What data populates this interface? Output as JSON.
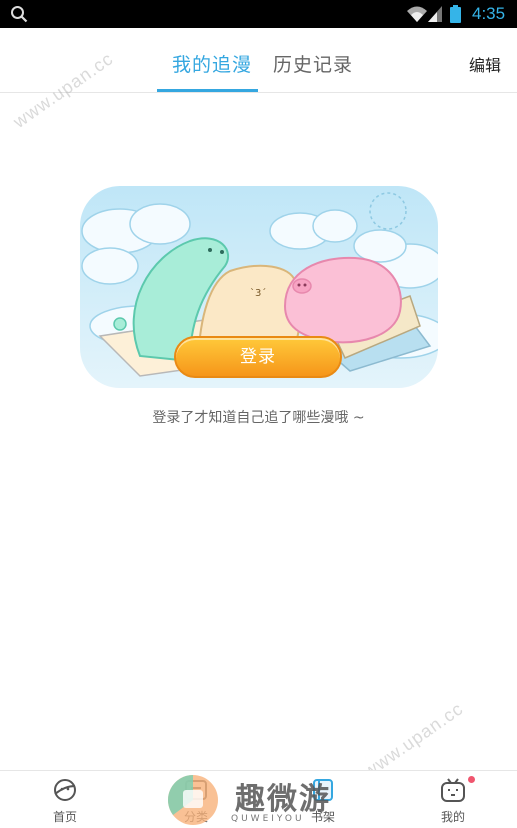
{
  "status_bar": {
    "time": "4:35",
    "icons": [
      "search-icon",
      "wifi-icon",
      "signal-icon",
      "battery-icon"
    ]
  },
  "header": {
    "tabs": [
      {
        "label": "我的追漫",
        "active": true
      },
      {
        "label": "历史记录",
        "active": false
      }
    ],
    "edit_label": "编辑",
    "accent_color": "#35a7e0"
  },
  "main": {
    "login_button_label": "登录",
    "login_hint": "登录了才知道自己追了哪些漫哦 ~"
  },
  "bottom_nav": {
    "items": [
      {
        "label": "首页",
        "icon": "planet-icon"
      },
      {
        "label": "分类",
        "icon": "category-icon"
      },
      {
        "label": "书架",
        "icon": "bookshelf-icon"
      },
      {
        "label": "我的",
        "icon": "tv-face-icon",
        "badge_color": "#f0566e"
      }
    ]
  },
  "watermarks": [
    "www.upan.cc",
    "www.upan.cc"
  ],
  "brand_overlay": {
    "text": "趣微游",
    "subtext": "QUWEIYOU"
  }
}
